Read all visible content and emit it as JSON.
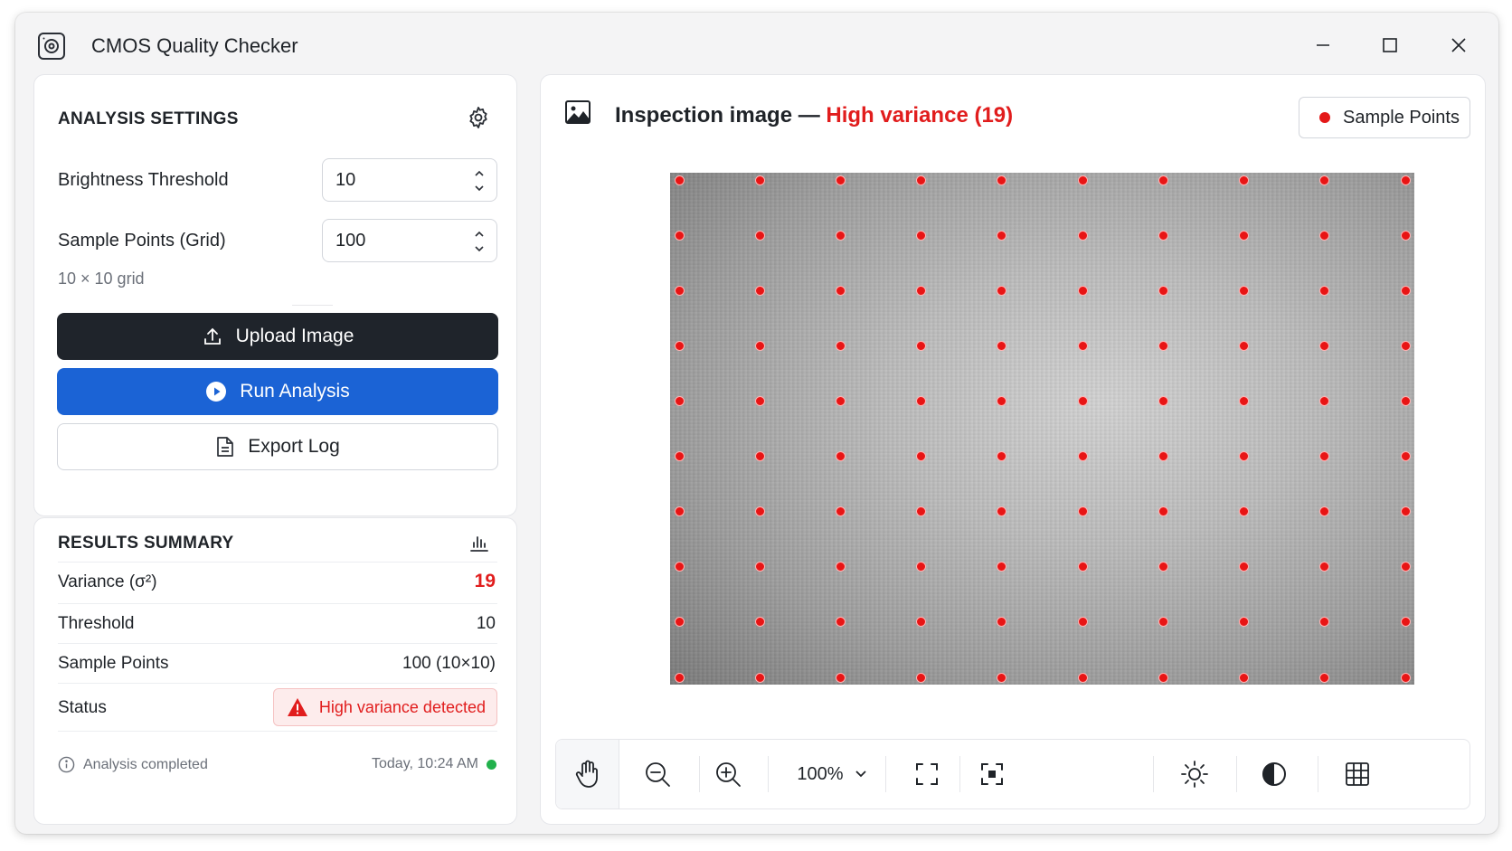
{
  "app": {
    "title": "CMOS Quality Checker"
  },
  "settings": {
    "title": "ANALYSIS SETTINGS",
    "brightness_label": "Brightness Threshold",
    "brightness_value": "10",
    "sample_label": "Sample Points (Grid)",
    "sample_value": "100",
    "grid_hint": "10 × 10 grid",
    "upload_label": "Upload Image",
    "run_label": "Run Analysis",
    "export_label": "Export Log"
  },
  "results": {
    "title": "RESULTS SUMMARY",
    "rows": [
      {
        "key": "Variance (σ²)",
        "value": "19"
      },
      {
        "key": "Threshold",
        "value": "10"
      },
      {
        "key": "Sample Points",
        "value": "100 (10×10)"
      },
      {
        "key": "Status",
        "value": "High variance detected"
      }
    ],
    "footer_status": "Analysis completed",
    "footer_time": "Today, 10:24 AM"
  },
  "viewer": {
    "title_prefix": "Inspection image — ",
    "title_status": "High variance (19)",
    "legend_label": "Sample Points",
    "zoom": "100%",
    "grid": {
      "cols": 10,
      "rows": 10
    }
  },
  "colors": {
    "accent_blue": "#1b63d5",
    "dark_button": "#1f242b",
    "alert_red": "#e11d1d",
    "sample_point": "#e81515",
    "ok_green": "#22b14c"
  },
  "icons": {
    "app": "camera-sensor-icon",
    "settings": "gear-icon",
    "upload": "upload-icon",
    "run": "play-circle-icon",
    "export": "document-icon",
    "results": "bar-chart-icon",
    "status": "warning-triangle-icon",
    "info": "info-icon",
    "viewer": "image-icon",
    "toolbar": [
      "hand-icon",
      "zoom-out-icon",
      "zoom-in-icon",
      "chevron-down-icon",
      "fit-screen-icon",
      "actual-size-icon",
      "brightness-icon",
      "contrast-icon",
      "grid-icon"
    ]
  }
}
